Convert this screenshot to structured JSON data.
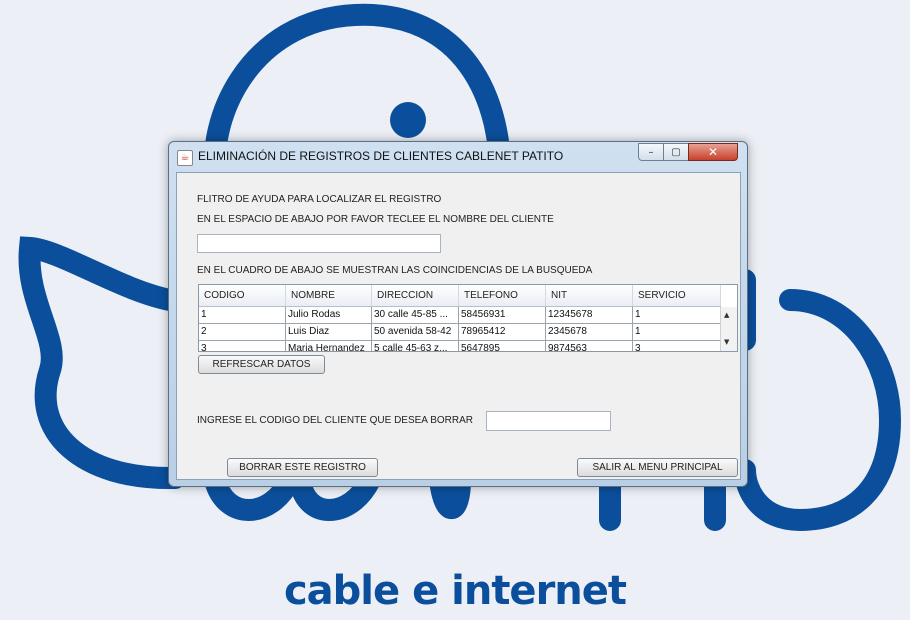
{
  "brand": {
    "tagline": "cable e internet"
  },
  "window": {
    "title": "ELIMINACIÓN DE REGISTROS DE CLIENTES CABLENET PATITO",
    "java_icon": "java-cup-icon",
    "controls": {
      "minimize": "–",
      "maximize": "▢",
      "close": "✕"
    }
  },
  "form": {
    "filter_title": "FLITRO DE AYUDA PARA LOCALIZAR EL REGISTRO",
    "filter_instruction": "EN EL ESPACIO DE ABAJO POR FAVOR TECLEE EL NOMBRE DEL CLIENTE",
    "search_value": "",
    "results_label": "EN EL CUADRO DE ABAJO SE MUESTRAN LAS COINCIDENCIAS DE LA BUSQUEDA",
    "refresh_label": "REFRESCAR DATOS",
    "code_label": "INGRESE EL CODIGO DEL CLIENTE QUE DESEA BORRAR",
    "code_value": "",
    "delete_label": "BORRAR ESTE REGISTRO",
    "exit_label": "SALIR AL MENU PRINCIPAL"
  },
  "table": {
    "columns": [
      "CODIGO",
      "NOMBRE",
      "DIRECCION",
      "TELEFONO",
      "NIT",
      "SERVICIO"
    ],
    "rows": [
      [
        "1",
        "Julio Rodas",
        "30 calle 45-85 ...",
        "58456931",
        "12345678",
        "1"
      ],
      [
        "2",
        "Luis Diaz",
        "50 avenida 58-42",
        "78965412",
        "2345678",
        "1"
      ],
      [
        "3",
        "Maria Hernandez",
        "5 calle 45-63 z...",
        "5647895",
        "9874563",
        "3"
      ]
    ]
  },
  "colors": {
    "brand_blue": "#0b4f9c",
    "background": "#ecf0f6"
  }
}
